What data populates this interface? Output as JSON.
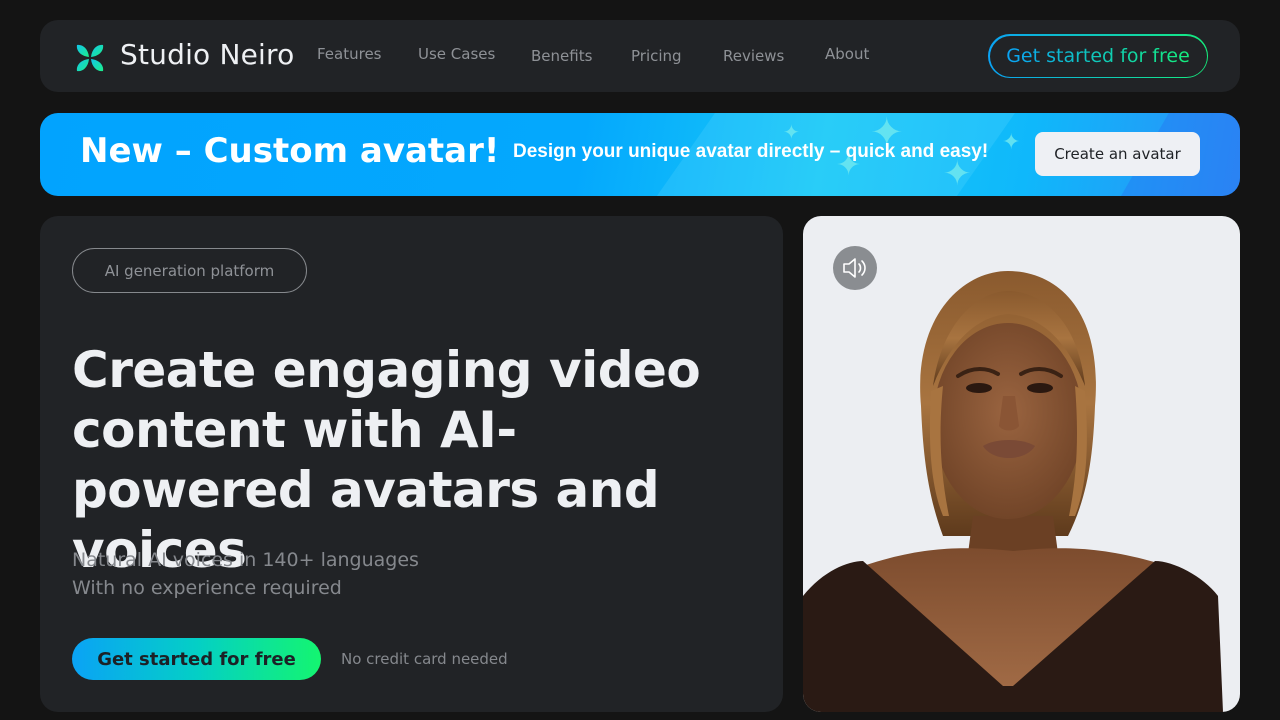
{
  "nav": {
    "brand": "Studio Neiro",
    "items": [
      {
        "label": "Features"
      },
      {
        "label": "Use Cases"
      },
      {
        "label": "Benefits"
      },
      {
        "label": "Pricing"
      },
      {
        "label": "Reviews"
      },
      {
        "label": "About"
      }
    ],
    "cta_label": "Get started for free"
  },
  "banner": {
    "title": "New – Custom avatar!",
    "text": "Design your unique avatar directly – quick and easy!",
    "button_label": "Create an avatar"
  },
  "hero": {
    "tag": "AI generation platform",
    "headline": "Create engaging video content with AI-powered avatars and voices",
    "sub_line_1": "Natural AI voices in 140+ languages",
    "sub_line_2": "With no experience required",
    "cta_label": "Get started for free",
    "note": "No credit card needed"
  },
  "video": {
    "sound_icon": "speaker-volume-icon",
    "subject": "avatar-woman-portrait"
  },
  "colors": {
    "page_bg": "#141414",
    "card_bg": "#212326",
    "gradient_start": "#0aa3f5",
    "gradient_end": "#15ee7d",
    "banner_blue": "#02a3fe"
  }
}
